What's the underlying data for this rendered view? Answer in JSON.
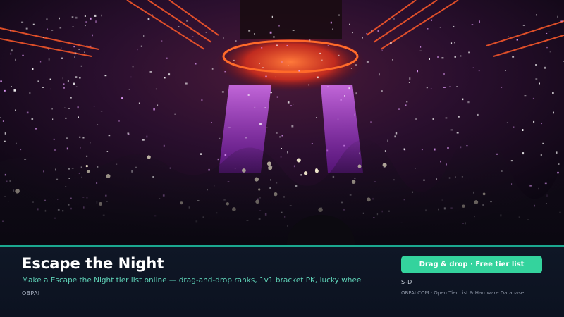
{
  "hero": {
    "scene": "concert-crowd-image",
    "colors": {
      "background": "#120818",
      "beam": "#c23cff",
      "stage_light": "#ff4a1a",
      "confetti": "#ffffff"
    }
  },
  "banner": {
    "title": "Escape the Night",
    "subtitle": "Make a Escape the Night tier list online — drag-and-drop ranks, 1v1 bracket PK, lucky whee",
    "brand": "OBPAI",
    "cta_label": "Drag & drop · Free tier list",
    "tier_range": "S–D",
    "footer_note": "OBPAI.COM · Open Tier List & Hardware Database",
    "colors": {
      "accent": "#34d39d",
      "subtitle": "#5fd3b8",
      "border": "#1ba88f"
    }
  }
}
